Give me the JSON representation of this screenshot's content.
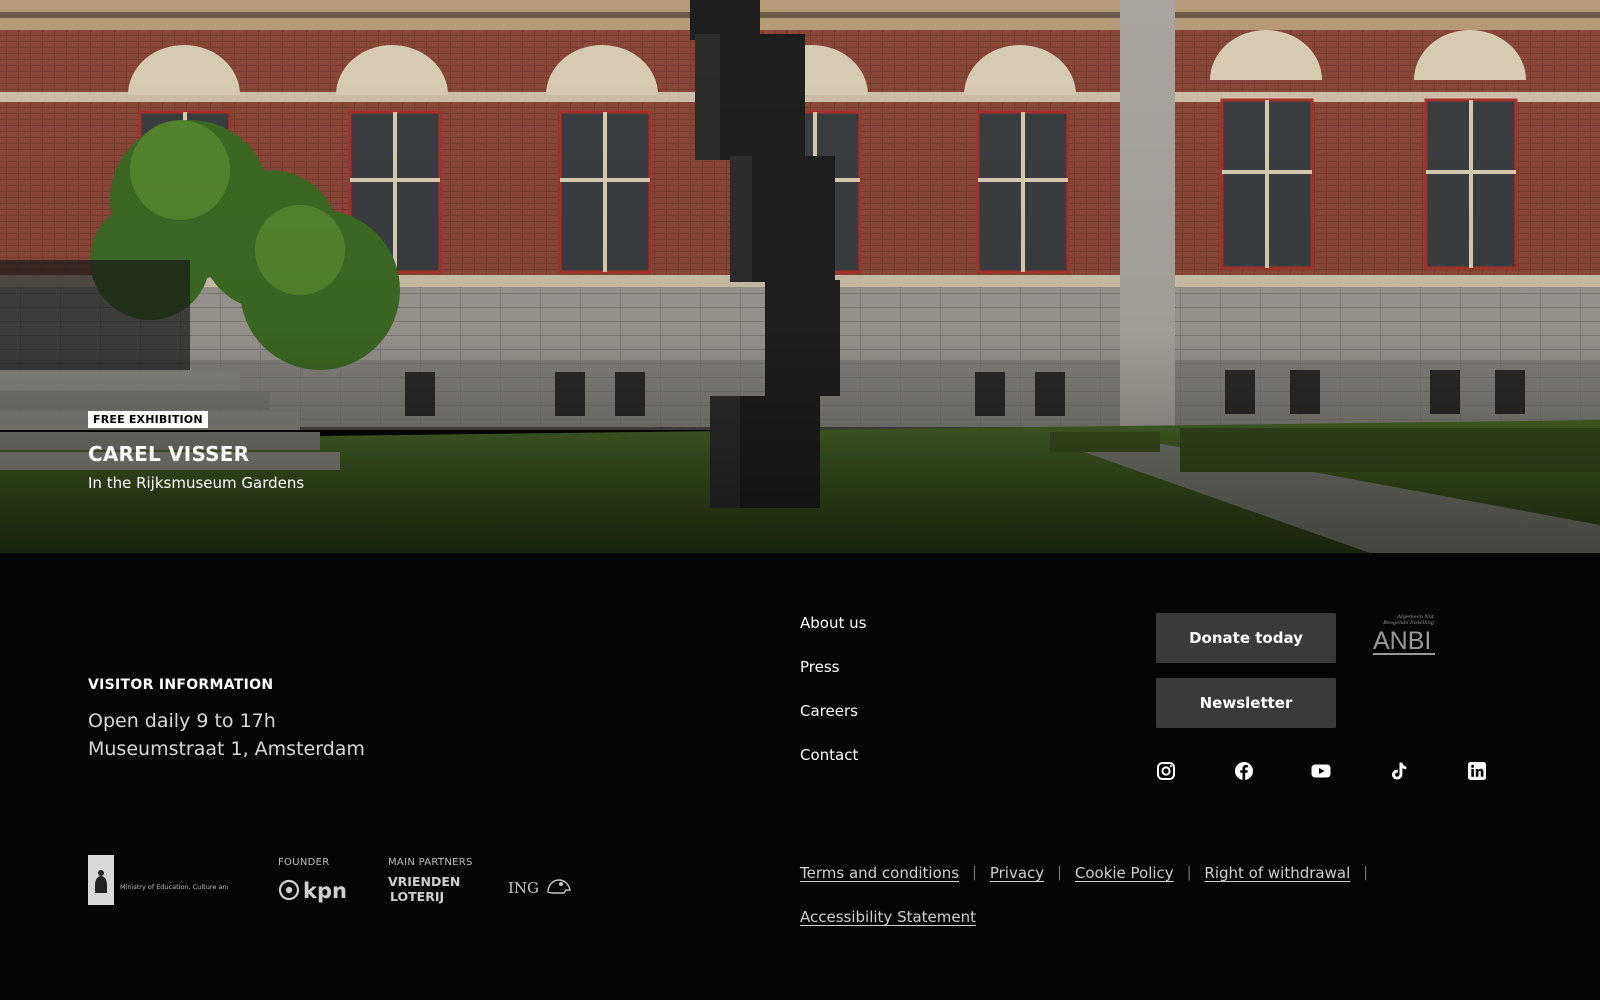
{
  "hero": {
    "badge": "FREE EXHIBITION",
    "title": "CAREL VISSER",
    "subtitle": "In the Rijksmuseum Gardens"
  },
  "visitor": {
    "heading": "VISITOR INFORMATION",
    "hours": "Open daily 9 to 17h",
    "address": "Museumstraat 1, Amsterdam"
  },
  "footer_links": [
    "About us",
    "Press",
    "Careers",
    "Contact"
  ],
  "buttons": {
    "donate": "Donate today",
    "newsletter": "Newsletter"
  },
  "anbi": {
    "small_text_1": "Algemeen Nut",
    "small_text_2": "Beogende Instelling",
    "wordmark": "ANBI"
  },
  "social_icons": [
    "instagram-icon",
    "facebook-icon",
    "youtube-icon",
    "tiktok-icon",
    "linkedin-icon"
  ],
  "partners": {
    "ministry": "Ministry of Education, Culture and Science",
    "founder_label": "FOUNDER",
    "founder": "kpn",
    "main_partners_label": "MAIN PARTNERS",
    "partner_1_line1": "VRIENDEN",
    "partner_1_line2": "LOTERIJ",
    "partner_2": "ING"
  },
  "legal_links": [
    "Terms and conditions",
    "Privacy",
    "Cookie Policy",
    "Right of withdrawal",
    "Accessibility Statement"
  ],
  "colors": {
    "background": "#050505",
    "button": "#3a3a3a",
    "brick": "#8e4a3b",
    "lawn": "#3f5a22"
  }
}
